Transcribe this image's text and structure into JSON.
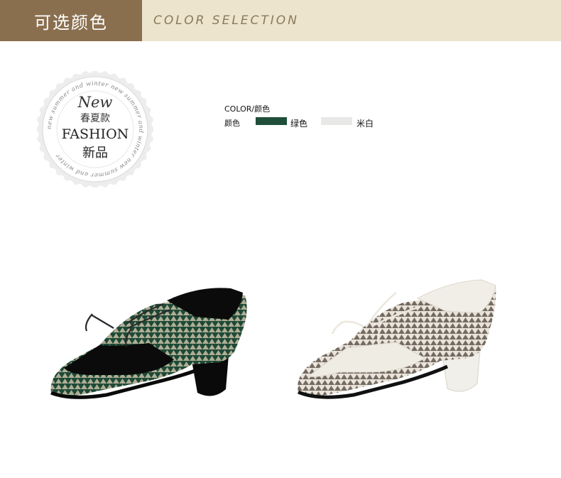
{
  "header": {
    "title_cn": "可选颜色",
    "title_en": "COLOR SELECTION",
    "bar_color": "#8a6f4f",
    "band_color": "#ece4cd"
  },
  "badge": {
    "ring_text": "new summer and winter new summer and winter new summer and winter",
    "new": "New",
    "cn_season": "春夏款",
    "fashion": "FASHION",
    "cn_new": "新品"
  },
  "colors": {
    "title": "COLOR/颜色",
    "row_label": "颜色",
    "options": [
      {
        "label": "绿色",
        "swatch": "#1f4f3a"
      },
      {
        "label": "米白",
        "swatch": "#e8e8e6"
      }
    ]
  },
  "products": [
    {
      "icon": "green-shoe-icon"
    },
    {
      "icon": "white-shoe-icon"
    }
  ]
}
